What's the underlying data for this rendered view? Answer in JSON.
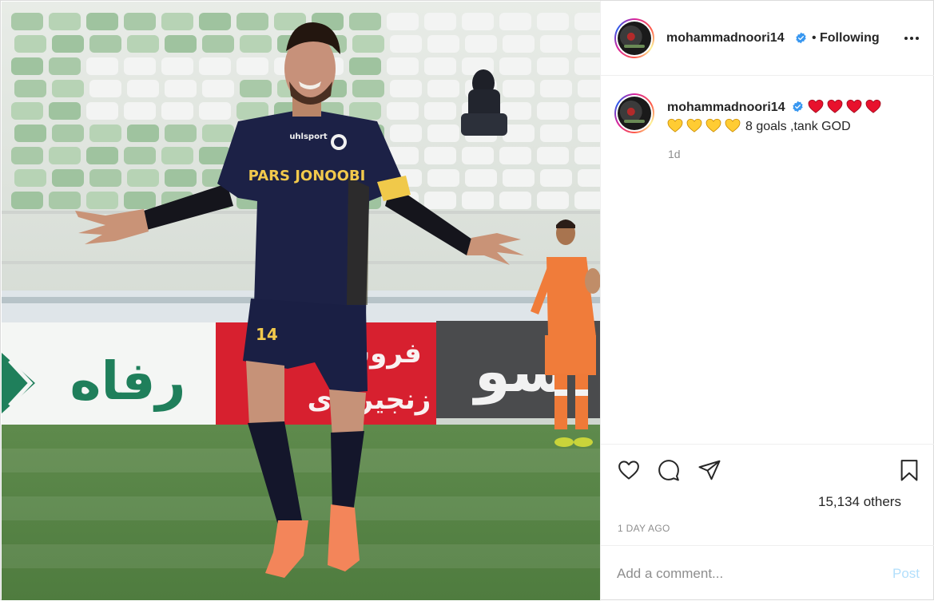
{
  "post": {
    "author": "mohammadnoori14",
    "follow_separator": "•",
    "follow_status": "Following",
    "caption": {
      "username": "mohammadnoori14",
      "text": "8 goals ,tank GOD",
      "hearts": [
        "red-heart",
        "red-heart",
        "red-heart",
        "red-heart",
        "yellow-heart",
        "yellow-heart",
        "yellow-heart",
        "yellow-heart"
      ],
      "age": "1d"
    },
    "likes_text": "15,134 others",
    "time_ago": "1 DAY AGO",
    "comment_placeholder": "Add a comment...",
    "post_label": "Post"
  },
  "photo": {
    "jersey_text": "PARS JONOOBI",
    "jersey_brand": "uhlsport",
    "shorts_number": "14",
    "ad_board": {
      "refah": "رفاه",
      "middle_line1": "فروش",
      "middle_line2": "زنجیره‌ای",
      "right": "سو"
    }
  },
  "colors": {
    "verified": "#3897f0",
    "red_heart": "#e8112d",
    "yellow_heart": "#ffcc33",
    "post_button": "#b2dffc",
    "secondary_text": "#8e8e8e"
  }
}
